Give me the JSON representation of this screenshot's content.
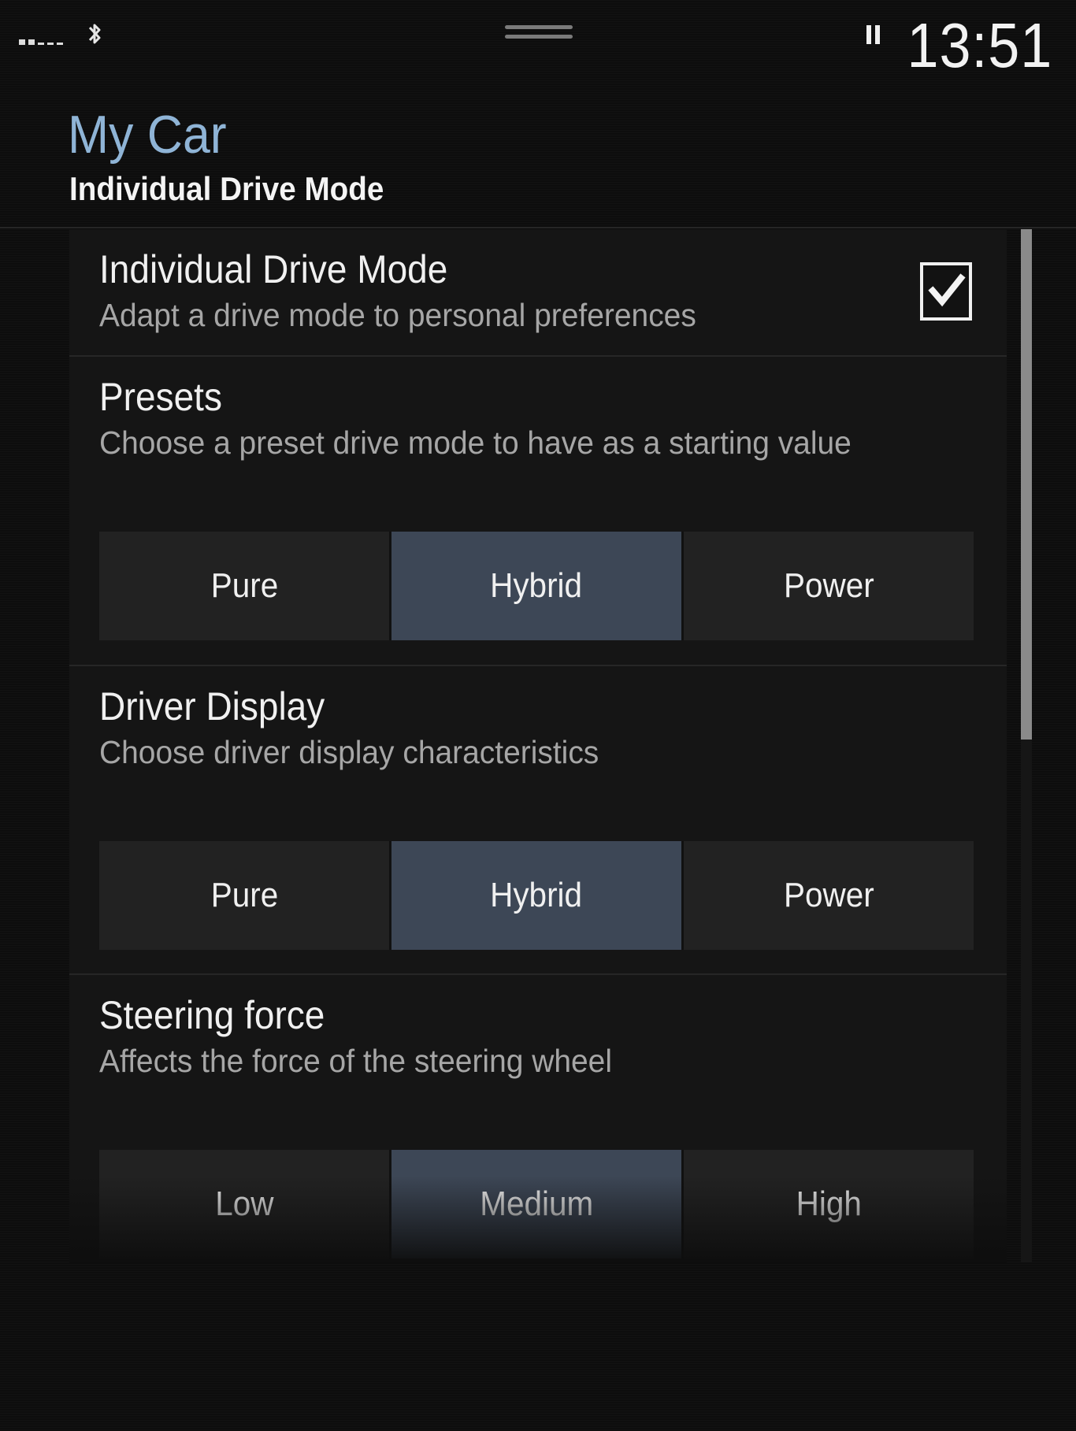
{
  "status_bar": {
    "clock": "13:51",
    "icons": [
      "signal-icon",
      "bluetooth-icon",
      "pull-down-handle-icon",
      "pause-icon"
    ]
  },
  "header": {
    "title": "My Car",
    "subtitle": "Individual Drive Mode"
  },
  "settings": {
    "drive_mode": {
      "title": "Individual Drive Mode",
      "description": "Adapt a drive mode to personal preferences",
      "checked": true
    },
    "presets": {
      "title": "Presets",
      "description": "Choose a preset drive mode to have as a starting value",
      "options": [
        "Pure",
        "Hybrid",
        "Power"
      ],
      "selected": "Hybrid"
    },
    "driver_display": {
      "title": "Driver Display",
      "description": "Choose driver display characteristics",
      "options": [
        "Pure",
        "Hybrid",
        "Power"
      ],
      "selected": "Hybrid"
    },
    "steering_force": {
      "title": "Steering force",
      "description": "Affects the force of the steering wheel",
      "options": [
        "Low",
        "Medium",
        "High"
      ],
      "selected": "Medium"
    }
  },
  "colors": {
    "accent_title": "#8fb4d6",
    "selected_segment": "#3d4756",
    "unselected_segment": "#222222"
  }
}
